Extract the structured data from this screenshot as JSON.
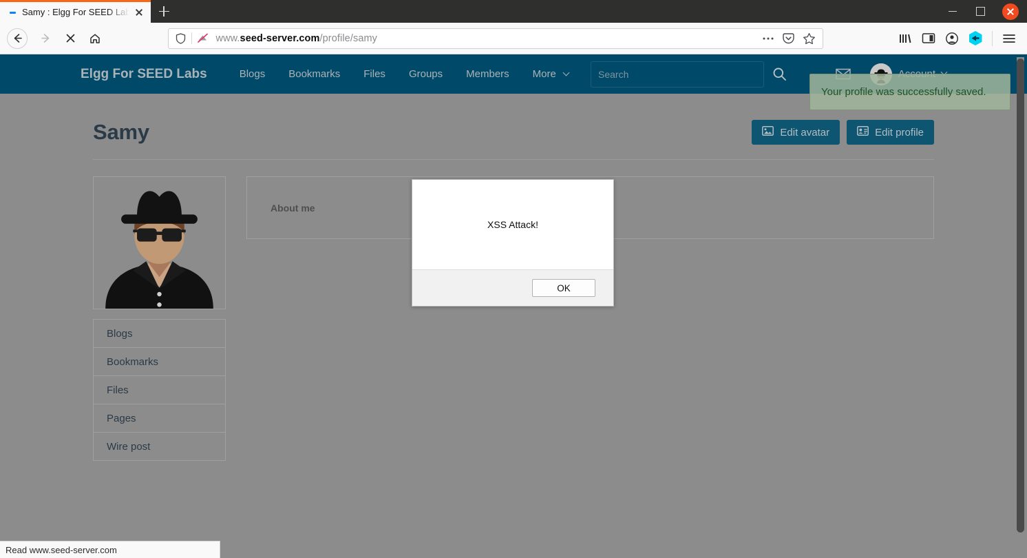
{
  "browser": {
    "tab": {
      "title": "Samy : Elgg For SEED Lab",
      "favicon": "dash-favicon",
      "close": "×"
    },
    "newtab_label": "+",
    "window_controls": {
      "minimize": "minimize-icon",
      "maximize": "maximize-icon",
      "close": "close-icon"
    },
    "toolbar": {
      "back": "back-arrow-icon",
      "forward": "forward-arrow-icon",
      "stop": "stop-x-icon",
      "home": "home-icon",
      "shield": "shield-icon",
      "protection": "tracking-protection-disabled-icon",
      "url_scheme": "www.",
      "url_domain": "seed-server.com",
      "url_path": "/profile/samy",
      "page_actions": "page-actions-icon",
      "pocket": "pocket-icon",
      "bookmark_star": "star-icon",
      "library": "library-icon",
      "sidebar": "sidebar-icon",
      "account": "account-icon",
      "extension": "extension-icon",
      "menu": "hamburger-menu-icon"
    },
    "statusbar": "Read www.seed-server.com"
  },
  "site": {
    "brand": "Elgg For SEED Labs",
    "nav": [
      {
        "label": "Blogs"
      },
      {
        "label": "Bookmarks"
      },
      {
        "label": "Files"
      },
      {
        "label": "Groups"
      },
      {
        "label": "Members"
      },
      {
        "label": "More"
      }
    ],
    "search": {
      "placeholder": "Search",
      "button": "search-icon"
    },
    "mail_icon": "envelope-icon",
    "account_label": "Account"
  },
  "notification": {
    "message": "Your profile was successfully saved.",
    "bg_color": "#a0b49b",
    "text_color": "#1f5325"
  },
  "page": {
    "title": "Samy",
    "actions": [
      {
        "label": "Edit avatar",
        "icon": "image-icon"
      },
      {
        "label": "Edit profile",
        "icon": "id-card-icon"
      }
    ],
    "sidebar_menu": [
      {
        "label": "Blogs"
      },
      {
        "label": "Bookmarks"
      },
      {
        "label": "Files"
      },
      {
        "label": "Pages"
      },
      {
        "label": "Wire post"
      }
    ],
    "about_title": "About me",
    "avatar_alt": "hacker-avatar"
  },
  "dialog": {
    "message": "XSS Attack!",
    "ok_label": "OK"
  },
  "colors": {
    "nav_bg": "#014968",
    "page_bg": "#8c8c8c",
    "button_bg": "#0d5571",
    "tab_accent": "#f96616"
  }
}
